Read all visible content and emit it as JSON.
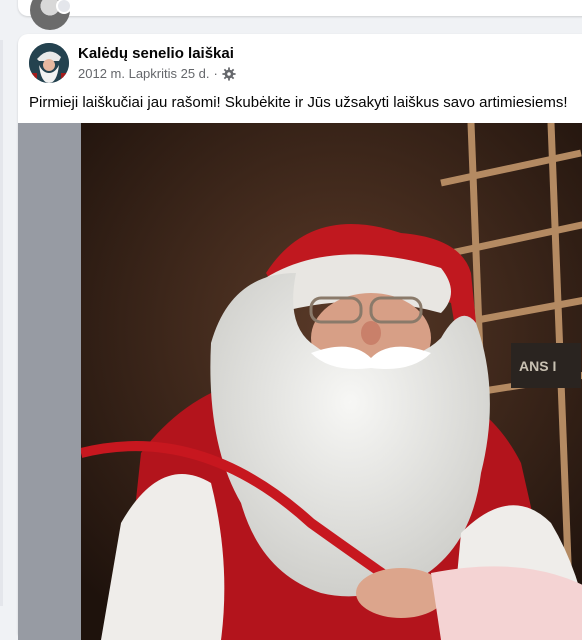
{
  "post": {
    "author": "Kalėdų senelio laiškai",
    "date": "2012 m. Lapkritis 25 d.",
    "separator": "·",
    "audience_icon": "gear-icon",
    "text": "Pirmieji laiškučiai jau rašomi! Skubėkite ir Jūs užsakyti laiškus savo artimiesiems!",
    "photo_sign_text": "ANS I"
  },
  "colors": {
    "page_bg": "#f0f2f5",
    "card_bg": "#ffffff",
    "text_primary": "#050505",
    "text_secondary": "#65676b",
    "santa_red": "#b3141c"
  }
}
